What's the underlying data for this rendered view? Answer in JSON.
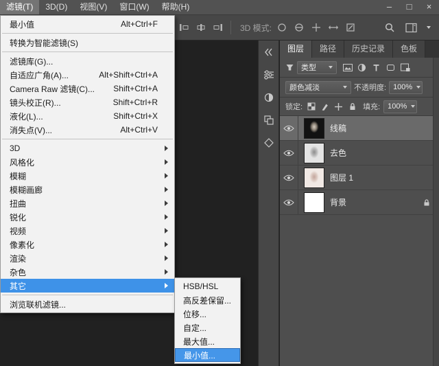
{
  "titlebar": {
    "minimize": "–",
    "restore": "□",
    "close": "×"
  },
  "menu_bar": {
    "items": [
      "滤镜(T)",
      "3D(D)",
      "视图(V)",
      "窗口(W)",
      "帮助(H)"
    ]
  },
  "options_bar": {
    "mode_label": "3D 模式:"
  },
  "filter_menu": {
    "items": [
      {
        "label": "最小值",
        "shortcut": "Alt+Ctrl+F"
      },
      {
        "label": "转换为智能滤镜(S)"
      },
      {
        "label": "滤镜库(G)..."
      },
      {
        "label": "自适应广角(A)...",
        "shortcut": "Alt+Shift+Ctrl+A"
      },
      {
        "label": "Camera Raw 滤镜(C)...",
        "shortcut": "Shift+Ctrl+A"
      },
      {
        "label": "镜头校正(R)...",
        "shortcut": "Shift+Ctrl+R"
      },
      {
        "label": "液化(L)...",
        "shortcut": "Shift+Ctrl+X"
      },
      {
        "label": "消失点(V)...",
        "shortcut": "Alt+Ctrl+V"
      },
      {
        "label": "3D"
      },
      {
        "label": "风格化"
      },
      {
        "label": "模糊"
      },
      {
        "label": "模糊画廊"
      },
      {
        "label": "扭曲"
      },
      {
        "label": "锐化"
      },
      {
        "label": "视频"
      },
      {
        "label": "像素化"
      },
      {
        "label": "渲染"
      },
      {
        "label": "杂色"
      },
      {
        "label": "其它",
        "highlighted": true
      },
      {
        "label": "浏览联机滤镜..."
      }
    ]
  },
  "other_submenu": {
    "items": [
      "HSB/HSL",
      "高反差保留...",
      "位移...",
      "自定...",
      "最大值...",
      "最小值..."
    ],
    "highlighted_item": "最小值..."
  },
  "layers_panel": {
    "tabs": [
      "图层",
      "路径",
      "历史记录",
      "色板"
    ],
    "filter_type_label": "类型",
    "blend_mode": "颜色减淡",
    "opacity_label": "不透明度:",
    "opacity_value": "100%",
    "lock_label": "锁定:",
    "fill_label": "填充:",
    "fill_value": "100%",
    "layers": [
      {
        "name": "线稿",
        "selected": true,
        "visible": true
      },
      {
        "name": "去色",
        "selected": false,
        "visible": true
      },
      {
        "name": "图层 1",
        "selected": false,
        "visible": true
      },
      {
        "name": "背景",
        "selected": false,
        "visible": true,
        "locked": true
      }
    ]
  },
  "icons": {
    "window": [
      "minimize-icon",
      "restore-icon",
      "close-icon"
    ],
    "options_bar": [
      "align-icons",
      "3d-orbit-icon",
      "3d-roll-icon",
      "3d-pan-icon",
      "3d-slide-icon",
      "3d-scale-icon",
      "search-icon",
      "workspace-switcher-icon"
    ],
    "dock": [
      "expand-panels-icon",
      "properties-panel-icon",
      "adjustments-panel-icon",
      "channels-panel-icon",
      "threed-panel-icon"
    ],
    "layers_panel": [
      "filter-funnel-icon",
      "filter-image-icon",
      "filter-adjustment-icon",
      "filter-type-icon",
      "filter-shape-icon",
      "filter-smart-object-icon",
      "lock-transparent-icon",
      "lock-pixels-icon",
      "lock-position-icon",
      "lock-all-icon",
      "eye-icon",
      "layer-lock-icon"
    ]
  },
  "colors": {
    "menu_highlight": "#3e92e8",
    "menu_bg": "#f2f2f2",
    "panel_bg": "#4e4e4e",
    "menubar_bg": "#525252",
    "workspace_bg": "#212121"
  }
}
